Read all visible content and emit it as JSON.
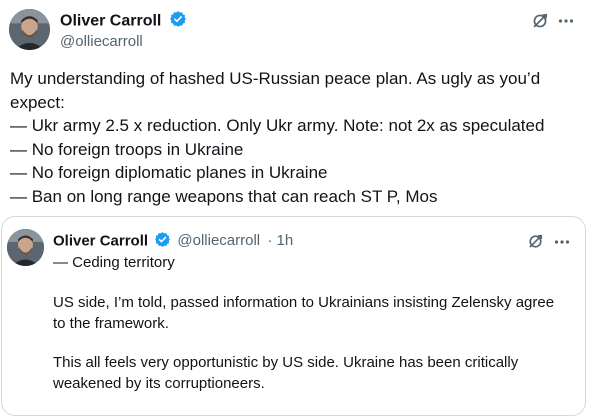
{
  "main_tweet": {
    "author_name": "Oliver Carroll",
    "author_handle": "@olliecarroll",
    "text_lines": [
      "My understanding of hashed US-Russian peace plan. As ugly as you’d",
      "expect:",
      "— Ukr army 2.5 x reduction. Only Ukr army. Note: not 2x as speculated",
      "— No foreign troops in Ukraine",
      "— No foreign diplomatic planes in Ukraine",
      "— Ban on long range weapons that can reach ST P, Mos"
    ]
  },
  "quoted_tweet": {
    "author_name": "Oliver Carroll",
    "author_handle": "@olliecarroll",
    "time": "· 1h",
    "lines": [
      "— Ceding territory",
      "US side, I’m told, passed information to Ukrainians insisting Zelensky agree",
      "to the framework.",
      "This all feels very opportunistic by US side. Ukraine has been critically",
      "weakened by its corruptioneers."
    ]
  },
  "icons": {
    "verified": "verified-badge-icon",
    "grok": "grok-icon",
    "more": "more-icon"
  },
  "colors": {
    "verified": "#1d9bf0",
    "text": "#0f1419",
    "secondary": "#536471",
    "border": "#cfd9de"
  }
}
